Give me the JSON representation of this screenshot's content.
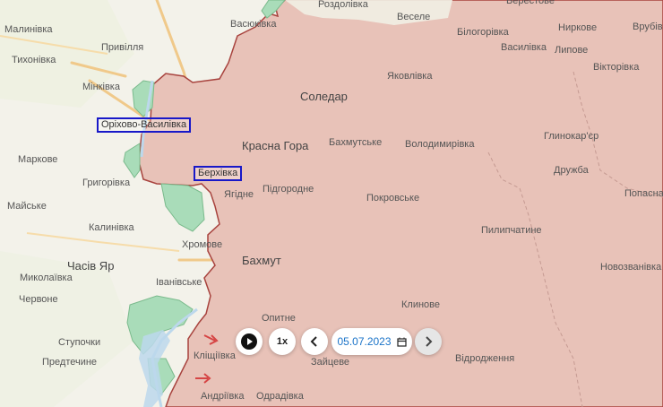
{
  "map": {
    "places": [
      {
        "id": "rozdolivka",
        "name": "Роздолівка"
      },
      {
        "id": "veselе",
        "name": "Веселе"
      },
      {
        "id": "berestove",
        "name": "Берестове"
      },
      {
        "id": "vasiukivka",
        "name": "Васюківка"
      },
      {
        "id": "malynivka",
        "name": "Малинівка"
      },
      {
        "id": "pryvillia",
        "name": "Привілля"
      },
      {
        "id": "tykhonivka",
        "name": "Тихонівка"
      },
      {
        "id": "minkivka",
        "name": "Мінківка"
      },
      {
        "id": "bilohorivka",
        "name": "Білогорівка"
      },
      {
        "id": "nyrkove",
        "name": "Ниркове"
      },
      {
        "id": "vrubivka",
        "name": "Врубів"
      },
      {
        "id": "vasylivka",
        "name": "Василівка"
      },
      {
        "id": "lypove",
        "name": "Липове"
      },
      {
        "id": "viktorivka",
        "name": "Вікторівка"
      },
      {
        "id": "yakovlivka",
        "name": "Яковлівка"
      },
      {
        "id": "soledar",
        "name": "Соледар"
      },
      {
        "id": "krasna_hora",
        "name": "Красна Гора"
      },
      {
        "id": "bakhmutske",
        "name": "Бахмутське"
      },
      {
        "id": "volodymyrivka",
        "name": "Володимирівка"
      },
      {
        "id": "hlynokarier",
        "name": "Глинокар'єр"
      },
      {
        "id": "markove",
        "name": "Маркове"
      },
      {
        "id": "druzhba",
        "name": "Дружба"
      },
      {
        "id": "hryhorivka",
        "name": "Григорівка"
      },
      {
        "id": "yahidne",
        "name": "Ягідне"
      },
      {
        "id": "pidhorodne",
        "name": "Підгородне"
      },
      {
        "id": "pokrovske",
        "name": "Покровське"
      },
      {
        "id": "popasna",
        "name": "Попасна"
      },
      {
        "id": "maiske",
        "name": "Майське"
      },
      {
        "id": "kalynivka",
        "name": "Калинівка"
      },
      {
        "id": "pylypchatyne",
        "name": "Пилипчатине"
      },
      {
        "id": "khromove",
        "name": "Хромове"
      },
      {
        "id": "chasiv_yar",
        "name": "Часів Яр"
      },
      {
        "id": "bakhmut",
        "name": "Бахмут"
      },
      {
        "id": "mykolaivka",
        "name": "Миколаївка"
      },
      {
        "id": "ivanivske",
        "name": "Іванівське"
      },
      {
        "id": "novozvanivka",
        "name": "Новозванівка"
      },
      {
        "id": "chervone",
        "name": "Червоне"
      },
      {
        "id": "klynove",
        "name": "Клинове"
      },
      {
        "id": "opytne",
        "name": "Опитне"
      },
      {
        "id": "stupochky",
        "name": "Ступочки"
      },
      {
        "id": "klishchiivka",
        "name": "Кліщіївка"
      },
      {
        "id": "predtechyne",
        "name": "Предтечине"
      },
      {
        "id": "zaitseve",
        "name": "Зайцеве"
      },
      {
        "id": "vidrodzhennia",
        "name": "Відродження"
      },
      {
        "id": "andriivka",
        "name": "Андріївка"
      },
      {
        "id": "odradivka",
        "name": "Одрадівка"
      }
    ],
    "highlighted": [
      {
        "id": "orikhovo",
        "name": "Оріхово-Василівка"
      },
      {
        "id": "berkhivka",
        "name": "Берхівка"
      }
    ],
    "colors": {
      "occupied": "#e8c2b8",
      "occupied_border": "#a8433e",
      "contested": "#a9dcb9",
      "water": "#bcd8ec",
      "road": "#f0c98a",
      "background": "#f3f2ea",
      "highlight_box": "#1818c8"
    }
  },
  "controls": {
    "play_icon": "play-icon",
    "speed_label": "1x",
    "prev_icon": "chevron-left-icon",
    "date_value": "05.07.2023",
    "calendar_icon": "calendar-icon",
    "next_icon": "chevron-right-icon"
  }
}
